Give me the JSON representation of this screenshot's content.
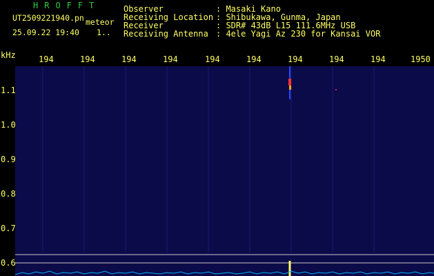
{
  "header": {
    "brand": "HROFFT",
    "filename": "UT2509221940.pn",
    "filename_suffix": "meteor",
    "timestamp": "25.09.22 19:40",
    "status": "1..",
    "fields": [
      {
        "label": "Observer",
        "value": ": Masaki Kano"
      },
      {
        "label": "Receiving Location",
        "value": ": Shibukawa, Gunma, Japan"
      },
      {
        "label": "Receiver",
        "value": ": SDR# 43dB L15 111.6MHz USB"
      },
      {
        "label": "Receiving Antenna",
        "value": ": 4ele Yagi Az 230 for Kansai VOR"
      }
    ]
  },
  "axes": {
    "y_unit": "kHz",
    "x_ticks": [
      "194",
      "194",
      "194",
      "194",
      "194",
      "194",
      "194",
      "194",
      "194",
      "1950"
    ],
    "y_ticks": [
      "1.1",
      "1.0",
      "0.9",
      "0.8",
      "0.7",
      "0.6"
    ]
  },
  "colors": {
    "background": "#000000",
    "plot_bg": "#0b0b4a",
    "text": "#ffff66",
    "brand": "#2ecc40",
    "signal": "#ff3030",
    "spectrum": "#00b4ff"
  }
}
